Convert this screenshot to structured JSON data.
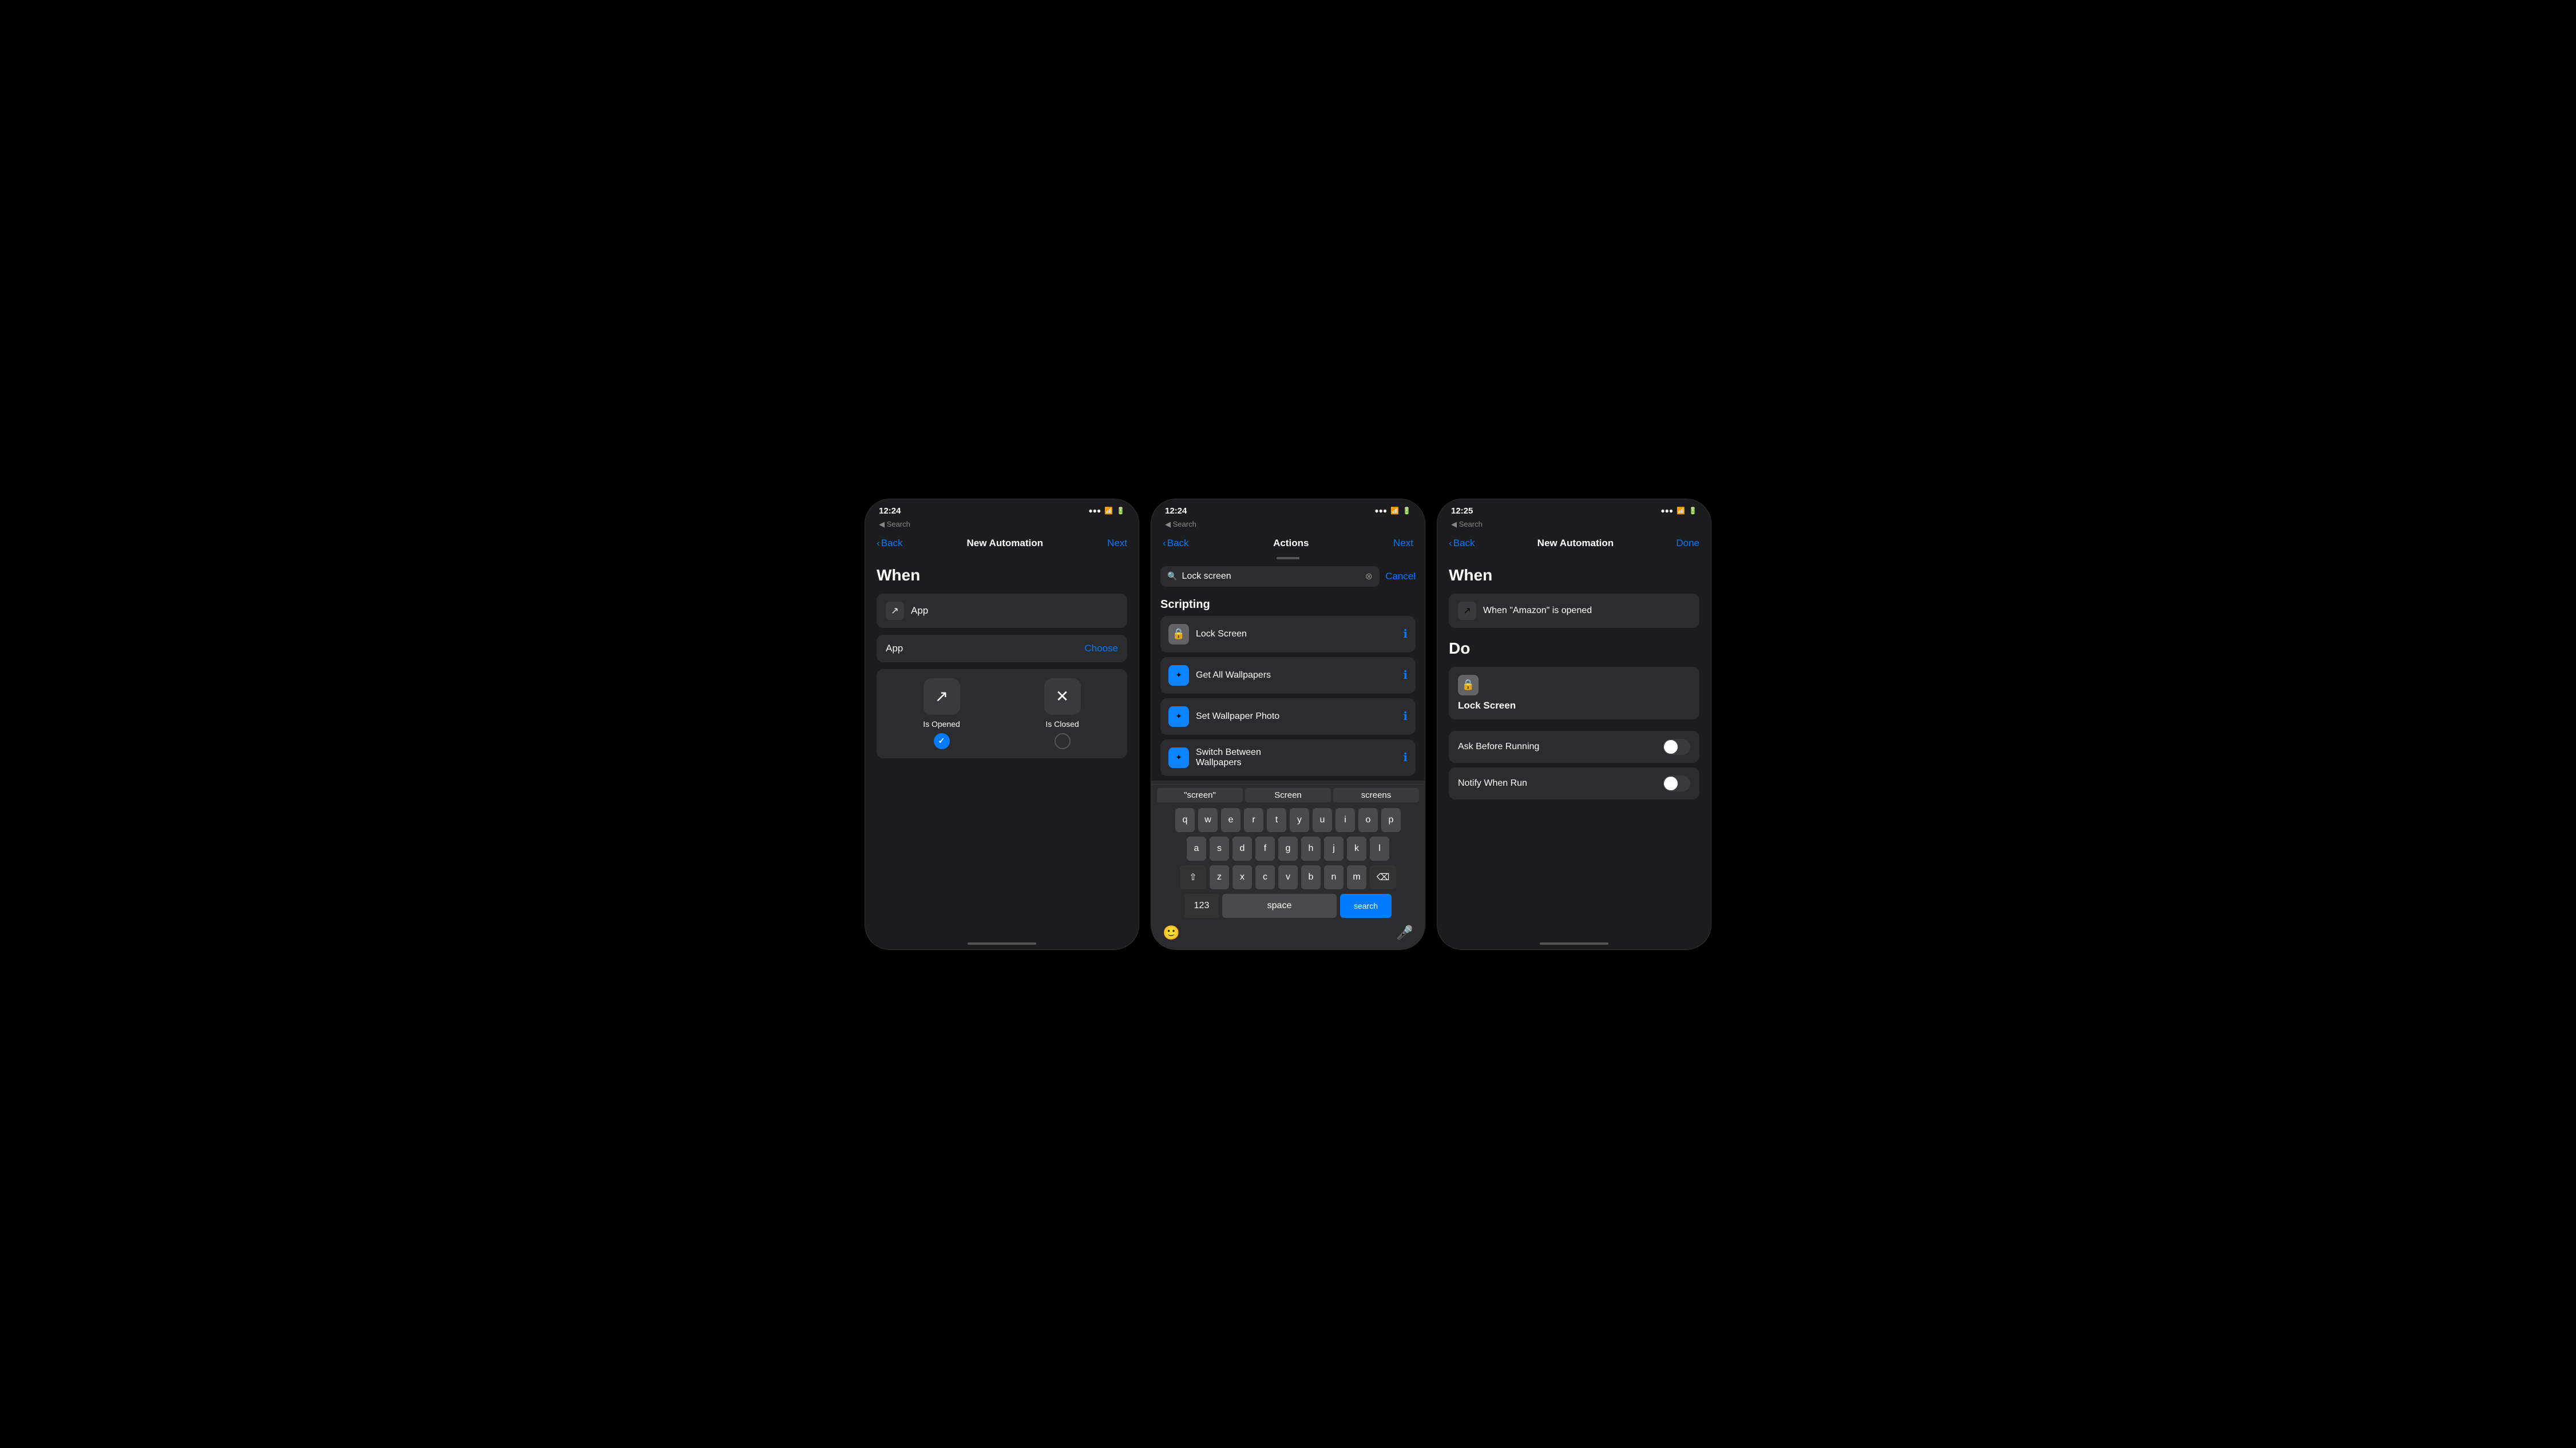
{
  "phone1": {
    "statusBar": {
      "time": "12:24",
      "signal": "●●●",
      "wifi": "WiFi",
      "battery": "60"
    },
    "searchBack": "◀ Search",
    "nav": {
      "back": "Back",
      "title": "New Automation",
      "action": "Next"
    },
    "sectionTitle": "When",
    "whenCard": {
      "icon": "↗",
      "label": "App"
    },
    "appRow": {
      "label": "App",
      "action": "Choose"
    },
    "choices": [
      {
        "icon": "↗",
        "label": "Is Opened",
        "selected": true
      },
      {
        "icon": "✕",
        "label": "Is Closed",
        "selected": false
      }
    ]
  },
  "phone2": {
    "statusBar": {
      "time": "12:24",
      "battery": "60"
    },
    "searchBack": "◀ Search",
    "nav": {
      "back": "Back",
      "title": "Actions",
      "action": "Next"
    },
    "searchValue": "Lock screen",
    "cancelLabel": "Cancel",
    "scriptingLabel": "Scripting",
    "actions": [
      {
        "icon": "🔒",
        "iconBg": "lock",
        "label": "Lock Screen"
      },
      {
        "icon": "✦",
        "iconBg": "blue",
        "label": "Get All Wallpapers"
      },
      {
        "icon": "✦",
        "iconBg": "blue",
        "label": "Set Wallpaper Photo"
      },
      {
        "icon": "✦",
        "iconBg": "blue",
        "label": "Switch Between Wallpapers"
      }
    ],
    "suggestions": [
      "\"screen\"",
      "Screen",
      "screens"
    ],
    "keyboard": {
      "rows": [
        [
          "q",
          "w",
          "e",
          "r",
          "t",
          "y",
          "u",
          "i",
          "o",
          "p"
        ],
        [
          "a",
          "s",
          "d",
          "f",
          "g",
          "h",
          "j",
          "k",
          "l"
        ],
        [
          "⇧",
          "z",
          "x",
          "c",
          "v",
          "b",
          "n",
          "m",
          "⌫"
        ]
      ],
      "bottomRow": {
        "numbers": "123",
        "space": "space",
        "search": "search"
      }
    }
  },
  "phone3": {
    "statusBar": {
      "time": "12:25",
      "battery": "60"
    },
    "searchBack": "◀ Search",
    "nav": {
      "back": "Back",
      "title": "New Automation",
      "action": "Done"
    },
    "whenTitle": "When",
    "whenCondition": {
      "icon": "↗",
      "text": "When \"Amazon\" is opened"
    },
    "doTitle": "Do",
    "doAction": {
      "icon": "🔒",
      "label": "Lock Screen"
    },
    "toggles": [
      {
        "label": "Ask Before Running",
        "on": false
      },
      {
        "label": "Notify When Run",
        "on": false
      }
    ]
  }
}
